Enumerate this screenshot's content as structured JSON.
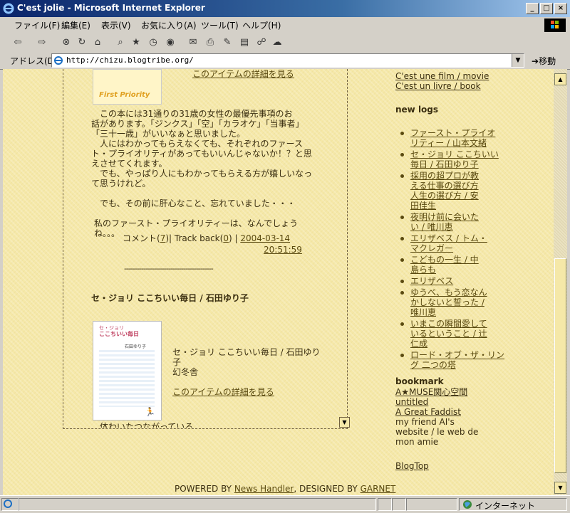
{
  "window": {
    "title": "C'est jolie - Microsoft Internet Explorer",
    "buttons": [
      "_",
      "□",
      "×"
    ]
  },
  "menu": [
    "ファイル(F)",
    "編集(E)",
    "表示(V)",
    "お気に入り(A)",
    "ツール(T)",
    "ヘルプ(H)"
  ],
  "toolbar_icons": [
    "back-icon",
    "forward-icon",
    "stop-icon",
    "refresh-icon",
    "home-icon",
    "search-icon",
    "favorites-icon",
    "history-icon",
    "mail-icon",
    "print-icon",
    "edit-icon",
    "discuss-icon",
    "messenger-icon"
  ],
  "address": {
    "label": "アドレス(D)",
    "url": "http://chizu.blogtribe.org/",
    "go_label": "移動"
  },
  "post1": {
    "detail_link": "このアイテムの詳細を見る",
    "book_cover_text": "First Priority",
    "body": [
      "この本には31通りの31歳の女性の最優先事項のお",
      "話があります。「ジンクス」「空」「カラオケ」「当事者」",
      "「三十一歳」がいいなぁと思いました。",
      "人にはわかってもらえなくても、それぞれのファース",
      "ト・プライオリティがあってもいいんじゃないか！？と思",
      "えさせてくれます。",
      "でも、やっぱり人にもわかってもらえる方が嬉しいなっ",
      "て思うけれど。",
      "",
      "でも、その前に肝心なこと、忘れていました・・・",
      "",
      "私のファースト・プライオリティーは、なんでしょうね。。。"
    ],
    "comment_label": "コメント",
    "comment_count": "7",
    "trackback_label": "Track back",
    "trackback_count": "0",
    "date": "2004-03-14",
    "time": "20:51:59",
    "separator": "------------------------------------------"
  },
  "post2": {
    "title": "セ・ジョリ ここちいい毎日 / 石田ゆり子",
    "book_title_line1": "セ・ジョリ ここちいい毎日 / 石田ゆり",
    "book_title_line2": "子",
    "publisher": "幻冬舎",
    "detail_link": "このアイテムの詳細を見る",
    "cover_title": "ここちいい毎日",
    "cover_subtitle": "セ・ジョリ",
    "cover_author": "石田ゆり子",
    "partial_text": "体わいたつながっている"
  },
  "sidebar": {
    "top_links": [
      "C'est une film / movie",
      "C'est un livre / book"
    ],
    "new_logs_title": "new logs",
    "new_logs": [
      [
        "ファースト・プライオ",
        "リティー / 山本文緒"
      ],
      [
        "セ・ジョリ ここちいい",
        "毎日 / 石田ゆり子"
      ],
      [
        "採用の超プロが教",
        "える仕事の選び方",
        "人生の選び方 / 安",
        "田佳生"
      ],
      [
        "夜明け前に会いた",
        "い / 唯川恵"
      ],
      [
        "エリザベス / トム・",
        "マクレガー"
      ],
      [
        "こどもの一生 / 中",
        "島らも"
      ],
      [
        "エリザベス"
      ],
      [
        "ゆうべ、もう恋なん",
        "かしないと誓った /",
        "唯川恵"
      ],
      [
        "いまこの瞬間愛して",
        "いるということ / 辻",
        "仁成"
      ],
      [
        "ロード・オブ・ザ・リン",
        "グ 二つの塔"
      ]
    ],
    "bookmark_title": "bookmark",
    "bookmarks": [
      "A★MUSE関心空間",
      "untitled",
      "A Great Faddist"
    ],
    "friend_text": [
      "my friend AI's",
      "website / le web de",
      "mon amie"
    ],
    "blogtop": "BlogTop"
  },
  "footer": {
    "powered": "POWERED BY ",
    "handler": "News Handler",
    "designed": ", DESIGNED BY ",
    "designer": "GARNET"
  },
  "status": {
    "zone": "インターネット"
  },
  "colors": {
    "page_bg": "#f5e8a8",
    "text": "#3a2e10",
    "link": "#5a4a10"
  }
}
